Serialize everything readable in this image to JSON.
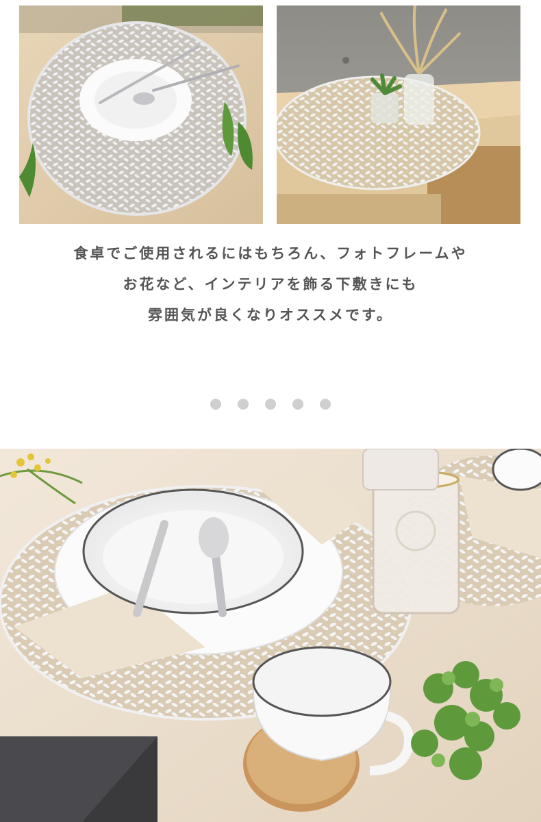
{
  "caption": {
    "lines": [
      "食卓でご使用されるにはもちろん、フォトフレームや",
      "お花など、インテリアを飾る下敷きにも",
      "雰囲気が良くなりオススメです。"
    ]
  },
  "carousel": {
    "dot_count": 5,
    "dot_color": "#cfcfcf"
  },
  "colors": {
    "wood": "#e6d2b4",
    "wall": "#9a9994",
    "mat": "#e8e8ea",
    "dish": "#fafafa",
    "napkin": "#ece2cf",
    "leaf": "#5e9a3c"
  }
}
